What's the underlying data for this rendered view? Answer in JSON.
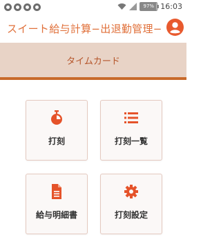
{
  "status_bar": {
    "battery": "97%",
    "time": "16:03"
  },
  "header": {
    "title": "スイート給与計算−出退勤管理−"
  },
  "tab": {
    "label": "タイムカード"
  },
  "menu": [
    {
      "label": "打刻",
      "icon": "stopwatch-icon"
    },
    {
      "label": "打刻一覧",
      "icon": "list-icon"
    },
    {
      "label": "給与明細書",
      "icon": "document-icon"
    },
    {
      "label": "打刻設定",
      "icon": "gear-icon"
    }
  ],
  "colors": {
    "accent": "#e0703a",
    "tab_background": "#e8d3c6",
    "tab_underline": "#c86a2b",
    "icon": "#e5532a"
  }
}
